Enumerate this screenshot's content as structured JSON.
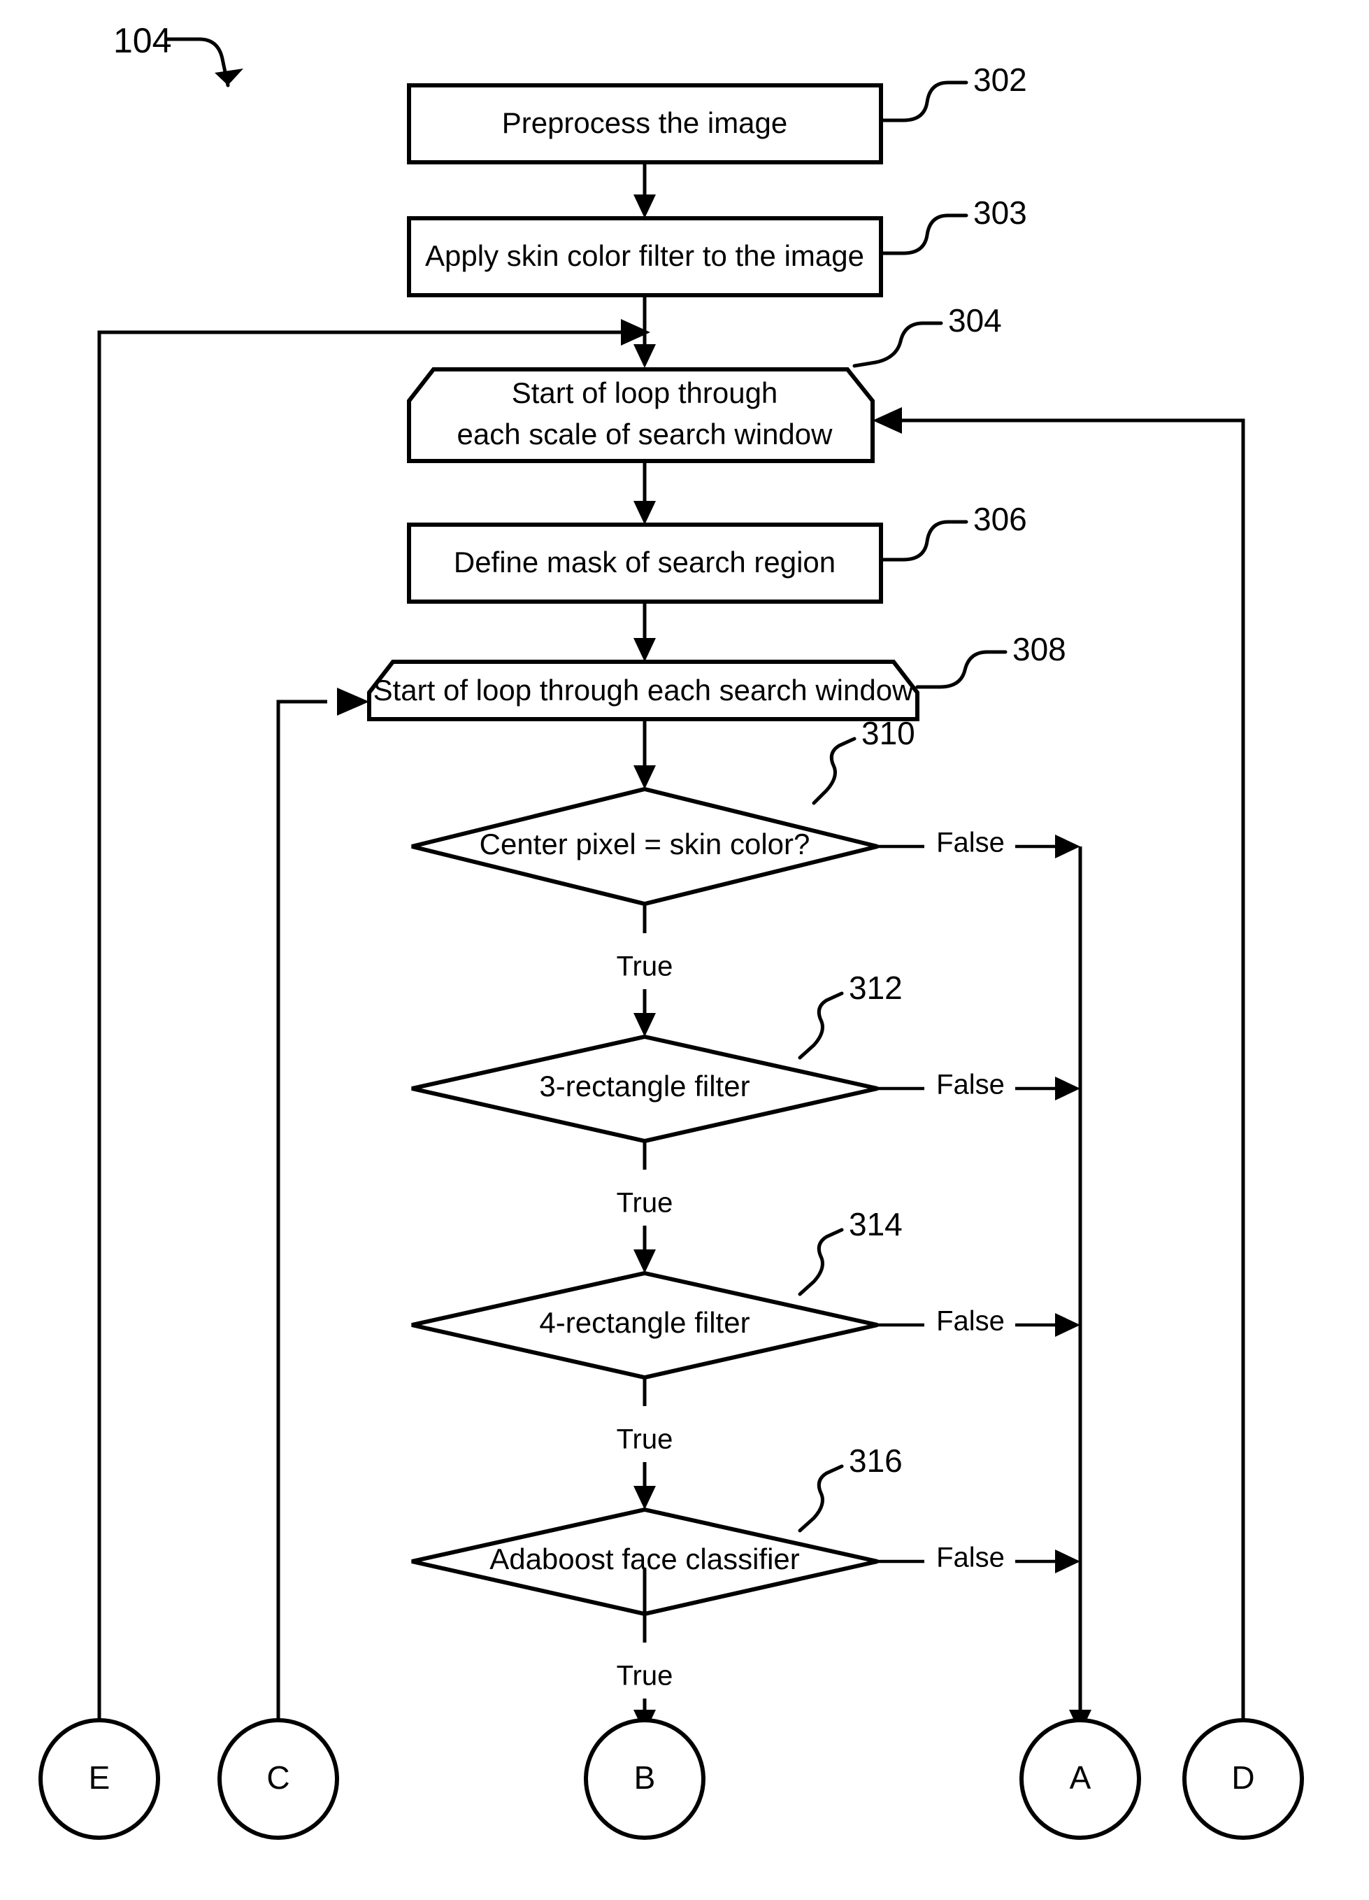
{
  "figure": {
    "label": "104",
    "title": "Face detection process flowchart"
  },
  "nodes": {
    "preprocess": {
      "ref": "302",
      "label": "Preprocess the image",
      "shape": "process"
    },
    "skin_filter": {
      "ref": "303",
      "label": "Apply skin color filter to the image",
      "shape": "process"
    },
    "loop_scale": {
      "ref": "304",
      "label_line1": "Start of loop through",
      "label_line2": "each scale of search window",
      "shape": "loop-start"
    },
    "define_mask": {
      "ref": "306",
      "label": "Define mask of search region",
      "shape": "process"
    },
    "loop_window": {
      "ref": "308",
      "label": "Start of loop through each search window",
      "shape": "loop-start"
    },
    "center_pixel": {
      "ref": "310",
      "label": "Center pixel = skin color?",
      "shape": "decision"
    },
    "filter3": {
      "ref": "312",
      "label": "3-rectangle filter",
      "shape": "decision"
    },
    "filter4": {
      "ref": "314",
      "label": "4-rectangle filter",
      "shape": "decision"
    },
    "adaboost": {
      "ref": "316",
      "label": "Adaboost face classifier",
      "shape": "decision"
    }
  },
  "edge_labels": {
    "true_1": "True",
    "true_2": "True",
    "true_3": "True",
    "true_4": "True",
    "false_1": "False",
    "false_2": "False",
    "false_3": "False",
    "false_4": "False"
  },
  "connectors": [
    {
      "id": "E",
      "label": "E"
    },
    {
      "id": "C",
      "label": "C"
    },
    {
      "id": "B",
      "label": "B"
    },
    {
      "id": "A",
      "label": "A"
    },
    {
      "id": "D",
      "label": "D"
    }
  ],
  "colors": {
    "stroke": "#000000",
    "fill": "#ffffff",
    "background": "#ffffff"
  }
}
